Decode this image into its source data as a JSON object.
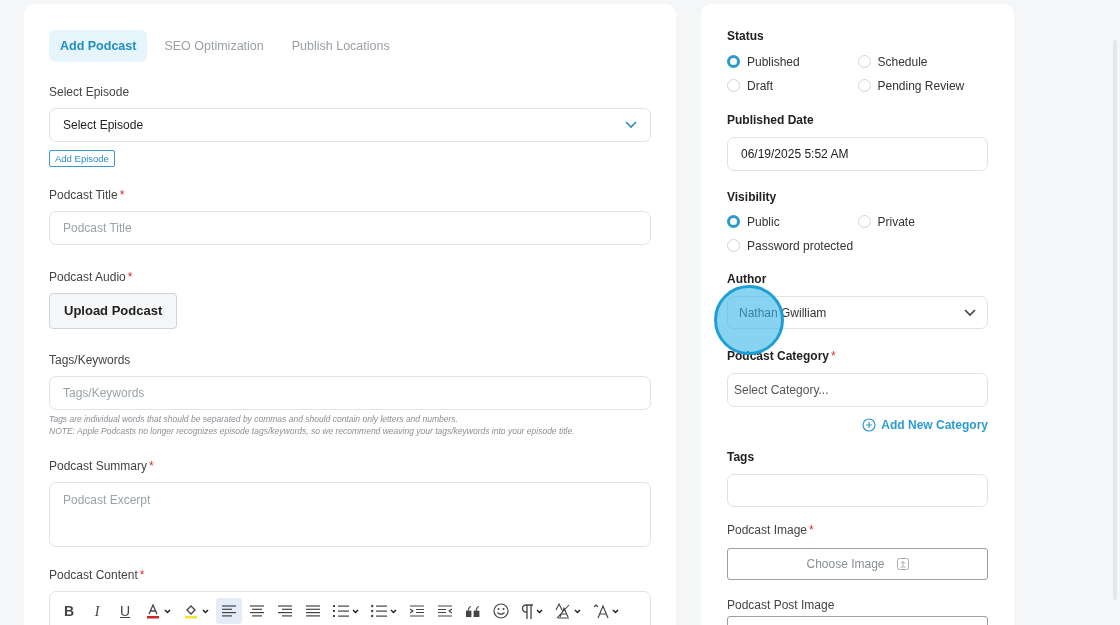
{
  "required_mark": "*",
  "tabs": [
    {
      "label": "Add Podcast",
      "selected": true
    },
    {
      "label": "SEO Optimization",
      "selected": false
    },
    {
      "label": "Publish Locations",
      "selected": false
    }
  ],
  "left_fields": [
    {
      "kind": "select",
      "label": "Select Episode",
      "value": "Select Episode",
      "required": false,
      "button": "Add Episode"
    },
    {
      "kind": "input",
      "label": "Podcast Title",
      "placeholder": "Podcast Title",
      "required": true
    },
    {
      "kind": "upload",
      "label": "Podcast Audio",
      "required": true,
      "button": "Upload Podcast"
    },
    {
      "kind": "input",
      "label": "Tags/Keywords",
      "placeholder": "Tags/Keywords",
      "required": false,
      "hints": [
        "Tags are individual words that should be separated by commas and should contain only letters and numbers.",
        "NOTE: Apple Podcasts no longer recognizes episode tags/keywords, so we recommend weaving your tags/keywords into your episode title."
      ]
    },
    {
      "kind": "textarea",
      "label": "Podcast Summary",
      "placeholder": "Podcast Excerpt",
      "required": true
    },
    {
      "kind": "editor",
      "label": "Podcast Content",
      "required": true
    }
  ],
  "toolbar": [
    {
      "kind": "bold",
      "label": "B",
      "selected": false,
      "dropdown": false
    },
    {
      "kind": "italic",
      "label": "I",
      "selected": false,
      "dropdown": false
    },
    {
      "kind": "underline",
      "label": "U",
      "selected": false,
      "dropdown": false
    },
    {
      "kind": "font-color",
      "selected": false,
      "dropdown": true
    },
    {
      "kind": "highlight",
      "selected": false,
      "dropdown": true
    },
    {
      "kind": "align-left",
      "selected": true,
      "dropdown": false
    },
    {
      "kind": "align-center",
      "selected": false,
      "dropdown": false
    },
    {
      "kind": "align-right",
      "selected": false,
      "dropdown": false
    },
    {
      "kind": "justify",
      "selected": false,
      "dropdown": false
    },
    {
      "kind": "ordered-list",
      "selected": false,
      "dropdown": true
    },
    {
      "kind": "bullet-list",
      "selected": false,
      "dropdown": true
    },
    {
      "kind": "indent",
      "selected": false,
      "dropdown": false
    },
    {
      "kind": "outdent",
      "selected": false,
      "dropdown": false
    },
    {
      "kind": "quote",
      "selected": false,
      "dropdown": false
    },
    {
      "kind": "emoji",
      "selected": false,
      "dropdown": false
    },
    {
      "kind": "paragraph",
      "selected": false,
      "dropdown": true
    },
    {
      "kind": "line-height",
      "selected": false,
      "dropdown": true
    },
    {
      "kind": "font-size",
      "selected": false,
      "dropdown": true
    }
  ],
  "status": {
    "label": "Status",
    "options": [
      {
        "label": "Published",
        "selected": true
      },
      {
        "label": "Schedule",
        "selected": false
      },
      {
        "label": "Draft",
        "selected": false
      },
      {
        "label": "Pending Review",
        "selected": false
      }
    ]
  },
  "published_date": {
    "label": "Published Date",
    "value": "06/19/2025 5:52 AM"
  },
  "visibility": {
    "label": "Visibility",
    "options": [
      {
        "label": "Public",
        "selected": true
      },
      {
        "label": "Private",
        "selected": false
      },
      {
        "label": "Password protected",
        "selected": false
      }
    ]
  },
  "author": {
    "label": "Author",
    "value": "Nathan Gwilliam"
  },
  "category": {
    "label": "Podcast Category",
    "required": true,
    "placeholder": "Select Category...",
    "link": "Add New Category"
  },
  "tags": {
    "label": "Tags"
  },
  "podcast_image": {
    "label": "Podcast Image",
    "required": true,
    "button": "Choose Image"
  },
  "post_image": {
    "label": "Podcast Post Image"
  }
}
